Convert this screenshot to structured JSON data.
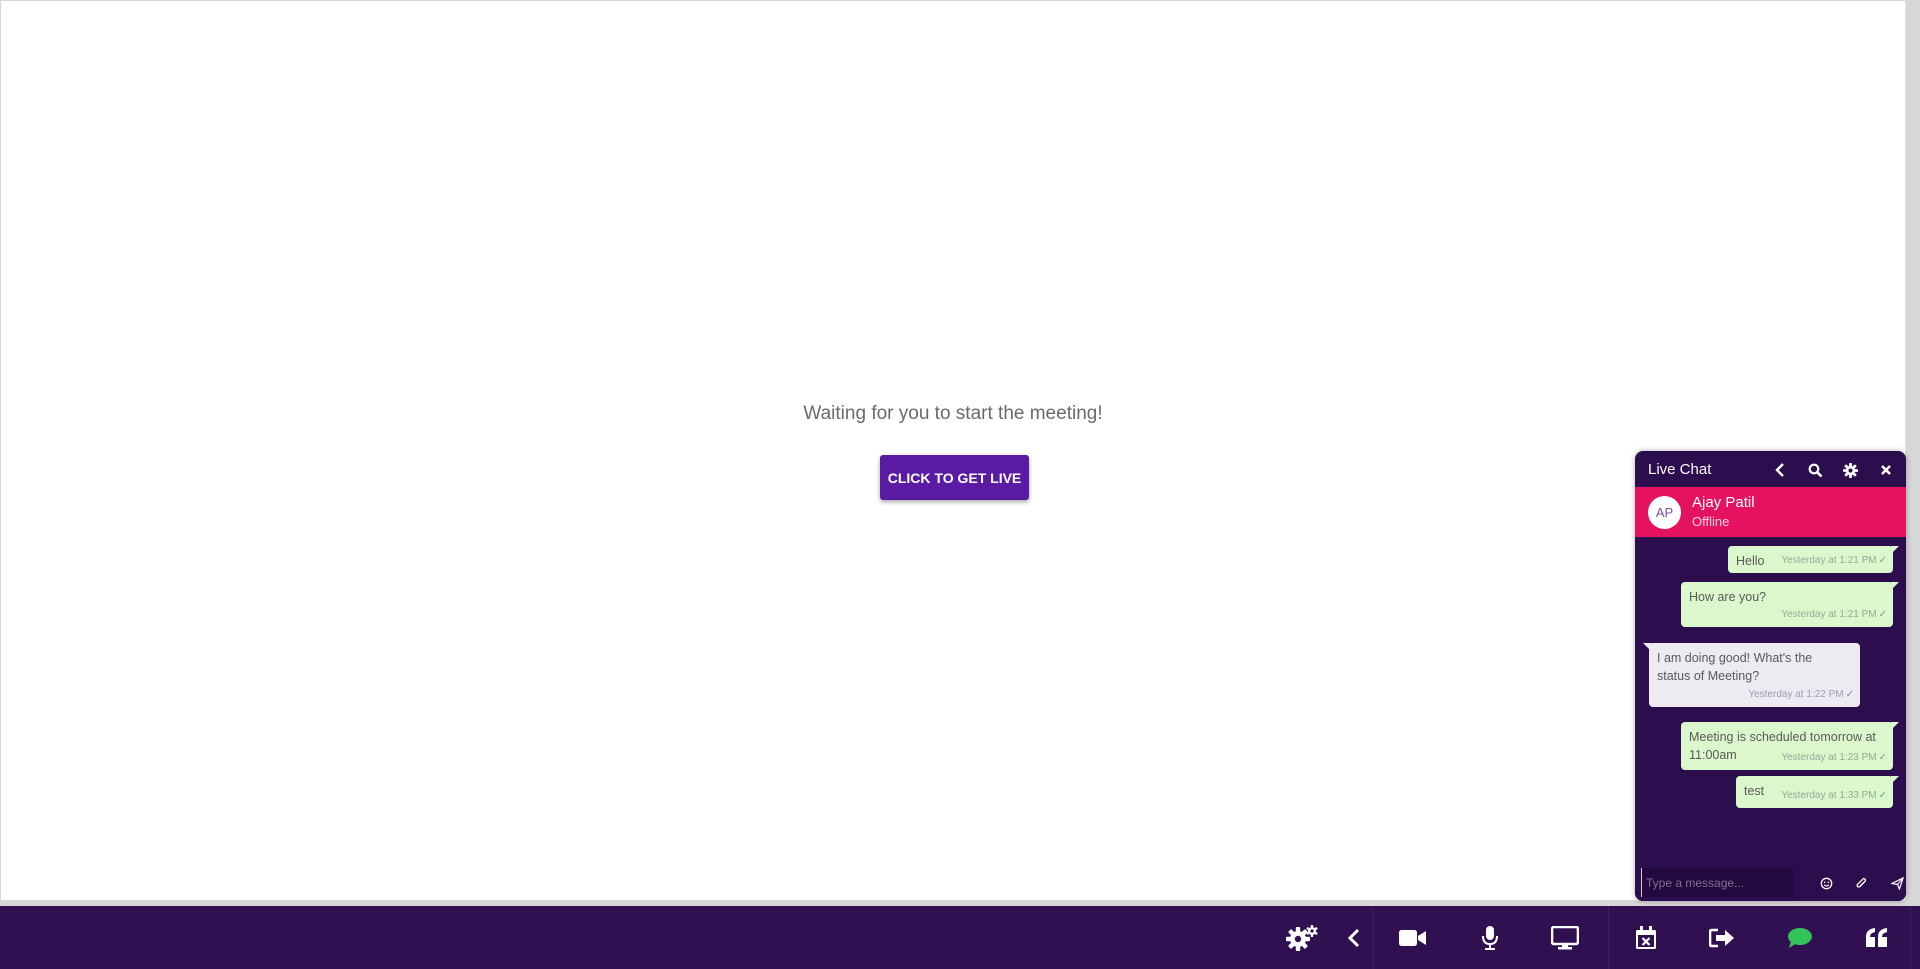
{
  "stage": {
    "waiting_text": "Waiting for you to start the meeting!",
    "live_button_label": "CLICK TO GET LIVE"
  },
  "chat": {
    "title": "Live Chat",
    "contact": {
      "initials": "AP",
      "name": "Ajay Patil",
      "status": "Offline"
    },
    "messages": [
      {
        "direction": "out",
        "text": "Hello",
        "time": "Yesterday at 1:21 PM"
      },
      {
        "direction": "out",
        "text": "How are you?",
        "time": "Yesterday at 1:21 PM"
      },
      {
        "direction": "in",
        "text": "I am doing good! What's the status of Meeting?",
        "time": "Yesterday at 1:22 PM"
      },
      {
        "direction": "out",
        "text": "Meeting is scheduled tomorrow at 11:00am",
        "time": "Yesterday at 1:23 PM"
      },
      {
        "direction": "out",
        "text": "test",
        "time": "Yesterday at 1:33 PM"
      }
    ],
    "compose_placeholder": "Type a message...",
    "header_icons": [
      "back-icon",
      "search-icon",
      "gear-icon",
      "close-icon"
    ],
    "compose_icons": [
      "emoji-icon",
      "paperclip-icon",
      "send-icon"
    ]
  },
  "toolbar": {
    "icons": [
      "gears-icon",
      "chevron-left-icon",
      "video-camera-icon",
      "microphone-icon",
      "desktop-icon",
      "calendar-remove-icon",
      "sign-out-icon",
      "chat-icon",
      "quote-icon"
    ],
    "chat_icon_color": "#33c15a"
  },
  "colors": {
    "toolbar_bg": "#311052",
    "chat_bg": "#2c0d4e",
    "contact_bar": "#e5135f",
    "primary_button": "#5b1aa4",
    "outgoing_bubble": "#daf8cb",
    "incoming_bubble": "#edeaf1"
  }
}
